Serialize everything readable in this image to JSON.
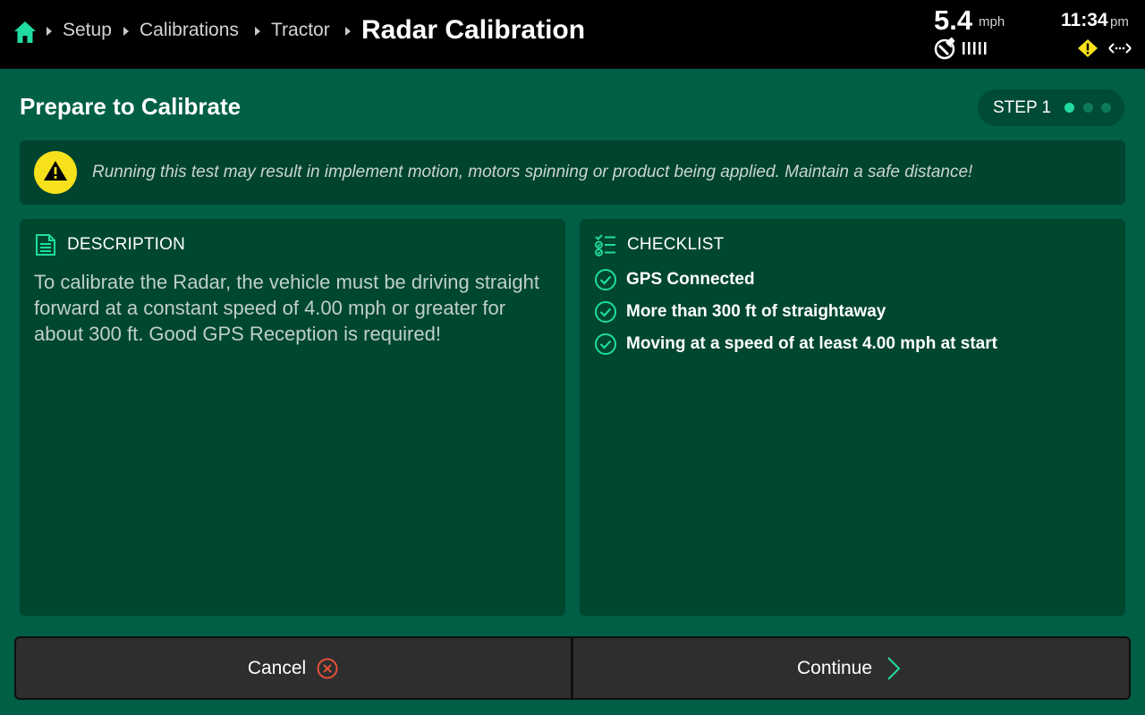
{
  "breadcrumb": {
    "home_icon": "home-icon",
    "items": [
      {
        "label": "Setup"
      },
      {
        "label": "Calibrations"
      },
      {
        "label": "Tractor"
      }
    ],
    "current": "Radar Calibration"
  },
  "status": {
    "speed_value": "5.4",
    "speed_unit": "mph",
    "time": "11:34",
    "ampm": "pm",
    "gps_icon": "gps-satellite-icon",
    "signal_icon": "signal-bars-icon",
    "warning_icon": "warning-diamond-icon",
    "connection_icon": "connection-arrows-icon"
  },
  "header": {
    "title": "Prepare to Calibrate",
    "step_label": "STEP 1",
    "step_total": 3,
    "step_current": 1
  },
  "warning": {
    "icon": "warning-triangle-icon",
    "text": "Running this test may result in implement motion, motors spinning or product being applied. Maintain a safe distance!"
  },
  "description": {
    "heading": "DESCRIPTION",
    "icon": "document-icon",
    "text": "To calibrate the Radar, the vehicle must be driving straight forward at a constant speed of 4.00 mph or greater for about 300 ft. Good GPS Reception is required!"
  },
  "checklist": {
    "heading": "CHECKLIST",
    "icon": "checklist-icon",
    "items": [
      {
        "label": "GPS Connected",
        "checked": true
      },
      {
        "label": "More than 300 ft of straightaway",
        "checked": true
      },
      {
        "label": "Moving at a speed of at least 4.00 mph at start",
        "checked": true
      }
    ]
  },
  "actions": {
    "cancel_label": "Cancel",
    "cancel_icon": "cancel-circle-icon",
    "continue_label": "Continue",
    "continue_icon": "chevron-right-icon"
  },
  "colors": {
    "background": "#005f44",
    "panel": "#00472f",
    "accent": "#20dca0",
    "warning_yellow": "#f7e11c",
    "cancel_red": "#e8503a"
  }
}
